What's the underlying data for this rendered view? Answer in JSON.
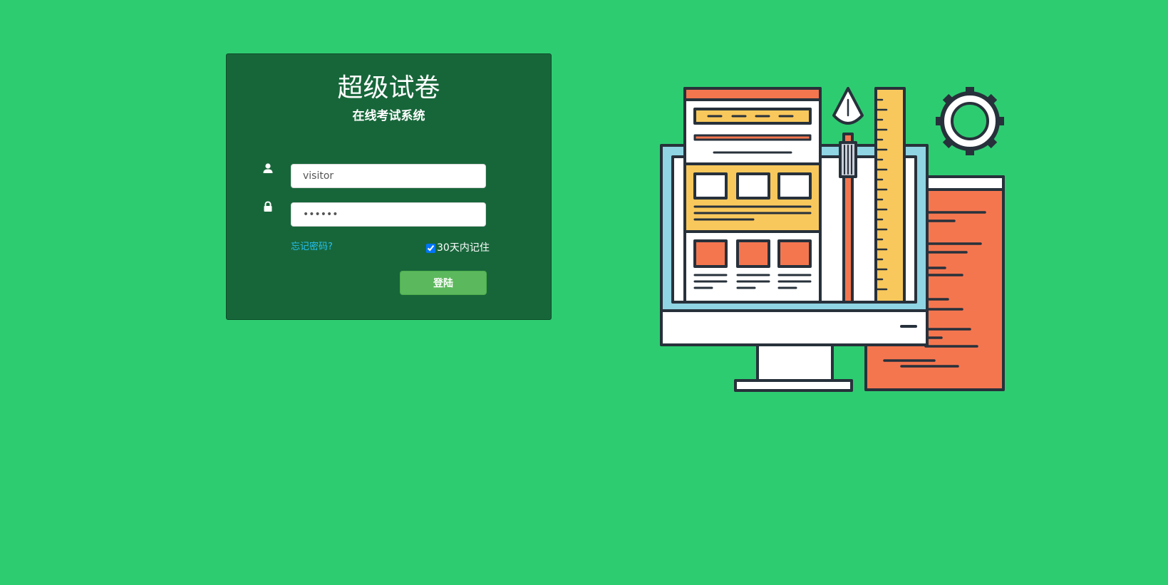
{
  "app": {
    "title": "超级试卷",
    "subtitle": "在线考试系统"
  },
  "login_form": {
    "username_value": "visitor",
    "password_value": "123456",
    "forgot_password_label": "忘记密码?",
    "remember_label": "30天内记住",
    "remember_checked": true,
    "submit_label": "登陆"
  },
  "icons": {
    "username": "user-icon",
    "password": "lock-icon",
    "illustration": "web-design-illustration"
  },
  "colors": {
    "background": "#2ecc71",
    "card": "#17663a",
    "button": "#5cb85c",
    "link": "#27c1f2"
  }
}
